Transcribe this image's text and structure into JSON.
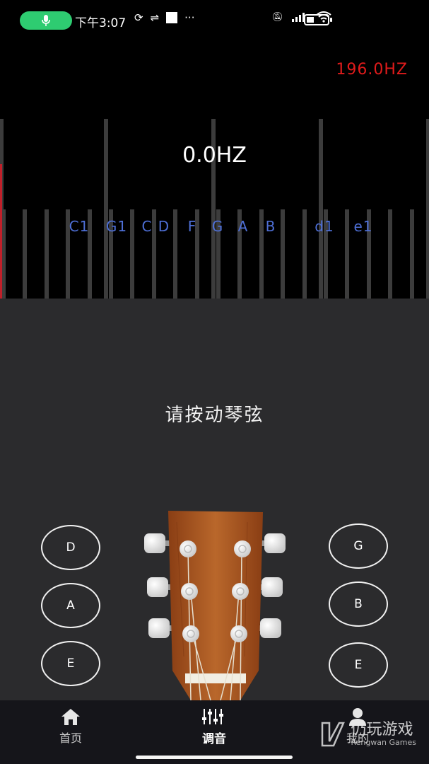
{
  "status": {
    "time": "下午3:07",
    "dots": "···"
  },
  "tuner": {
    "target_frequency": "196.0HZ",
    "current_frequency": "0.0HZ",
    "notes": [
      "C1",
      "G1",
      "C",
      "D",
      "F",
      "G",
      "A",
      "B",
      "d1",
      "e1"
    ]
  },
  "prompt": "请按动琴弦",
  "strings": {
    "left": [
      "D",
      "A",
      "E"
    ],
    "right": [
      "G",
      "B",
      "E"
    ]
  },
  "nav": {
    "items": [
      {
        "label": "首页",
        "icon": "home-icon"
      },
      {
        "label": "调音",
        "icon": "sliders-icon"
      },
      {
        "label": "我的",
        "icon": "profile-icon"
      }
    ],
    "active": "调音"
  },
  "watermark": {
    "title": "仍玩游戏",
    "subtitle": "Rengwan Games"
  },
  "colors": {
    "target_hz": "#e01b1b",
    "note_labels": "#4e6fd6",
    "headstock_wood": "#b05a22",
    "mic_pill": "#2ecc71"
  }
}
